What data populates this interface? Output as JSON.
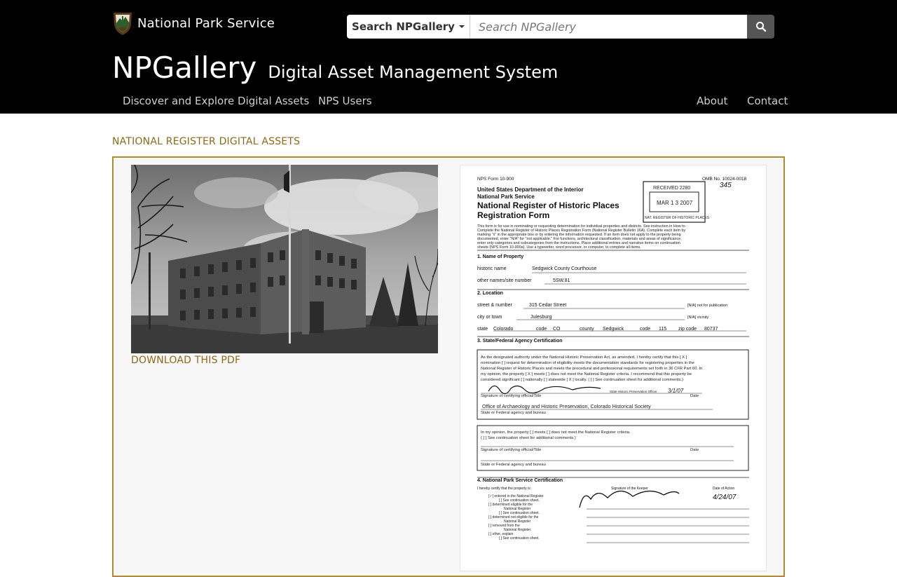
{
  "header": {
    "agency_name": "National Park Service",
    "search_scope": "Search NPGallery",
    "search_placeholder": "Search NPGallery",
    "search_icon": "search-icon",
    "title": "NPGallery",
    "subtitle": "Digital Asset Management System"
  },
  "nav": {
    "discover": "Discover and Explore Digital Assets",
    "nps_users": "NPS Users",
    "about": "About",
    "contact": "Contact"
  },
  "main": {
    "section_title": "NATIONAL REGISTER DIGITAL ASSETS",
    "download_label": "DOWNLOAD THIS PDF"
  },
  "document": {
    "form_no": "NPS Form 10-900",
    "omb_no": "OMB No. 10024-0018",
    "handwritten_no": "345",
    "dept": "United States Department of the Interior",
    "service": "National Park Service",
    "title_1": "National Register of Historic Places",
    "title_2": "Registration Form",
    "stamp_received": "RECEIVED 2280",
    "stamp_date": "MAR 1 3 2007",
    "stamp_footer": "NAT. REGISTER OF HISTORIC PLACES",
    "intro_1": "This form is for use in nominating or requesting determination for individual properties and districts. See instruction in How to",
    "intro_2": "Complete the National Register of Historic Places Registration Form (National Register Bulletin 16A). Complete each item by",
    "intro_3": "marking \"x\" in the appropriate box or by entering the information requested. If an item does not apply to the property being",
    "intro_4": "documented, enter \"N/A\" for \"not applicable.\" For functions, architectural classification, materials and areas of significance,",
    "intro_5": "enter only categories and subcategories from the instructions. Place additional entries and narrative items on continuation",
    "intro_6": "sheets (NPS Form 10-900a). Use a typewriter, word processor, or computer, to complete all items.",
    "s1": "1. Name of Property",
    "historic_name_label": "historic name",
    "historic_name": "Sedgwick County Courthouse",
    "other_names_label": "other names/site number",
    "other_names": "5SW.81",
    "s2": "2. Location",
    "street_label": "street & number",
    "street": "315 Cedar Street",
    "not_pub": "[N/A] not for publication",
    "city_label": "city or town",
    "city": "Julesburg",
    "vicinity": "[N/A] vicinity",
    "state_label": "state",
    "state": "Colorado",
    "code_label": "code",
    "state_code": "CO",
    "county_label": "county",
    "county": "Sedgwick",
    "county_code": "115",
    "zip_label": "zip code",
    "zip": "80737",
    "s3": "3. State/Federal Agency Certification",
    "cert_1": "As the designated authority under the National Historic Preservation Act, as amended, I hereby certify that this [ X ]",
    "cert_2": "nomination [ ] request for determination of eligibility meets the documentation standards for registering properties in the",
    "cert_3": "National Register of Historic Places and meets the procedural and professional requirements set forth in 36 CFR Part 60. In",
    "cert_4": "my opinion, the property [ X ] meets [ ] does not meet the National Register criteria. I recommend that this property be",
    "cert_5": "considered significant [ ] nationally [ ] statewide [ X ] locally. ( [ ] See continuation sheet for additional comments.)",
    "sig_official_label": "Signature of certifying official/Title",
    "shpo_label": "State Historic Preservation Officer",
    "date_label": "Date",
    "sig_date": "3/1/07",
    "agency": "Office of Archaeology and Historic Preservation, Colorado Historical Society",
    "agency_label": "State or Federal agency and bureau",
    "opinion_1": "In my opinion, the property [ ] meets [ ] does not meet the National Register criteria.",
    "opinion_2": "( [ ] See continuation sheet for additional comments.)",
    "sig_official_label_2": "Signature of certifying official/Title",
    "date_label_2": "Date",
    "agency_label_2": "State or Federal agency and bureau",
    "s4": "4. National Park Service Certification",
    "nps_cert": "I hereby certify that the property is:",
    "keeper_label": "Signature of the Keeper",
    "action_label": "Date of Action",
    "action_date": "4/24/07",
    "opt_1": "[✓] entered in the National Register",
    "opt_1b": "[ ] See continuation sheet.",
    "opt_2": "[ ] determined eligible for the",
    "opt_2b": "National Register",
    "opt_2c": "[ ] See continuation sheet.",
    "opt_3": "[ ] determined not eligible for the",
    "opt_3b": "National Register",
    "opt_4": "[ ] removed from the",
    "opt_4b": "National Register",
    "opt_5": "[ ] other, explain",
    "opt_5b": "[ ] See continuation sheet."
  }
}
